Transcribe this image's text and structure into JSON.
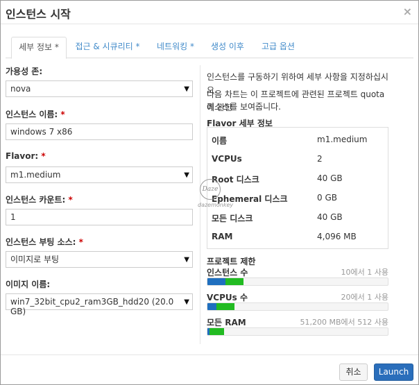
{
  "dialog": {
    "title": "인스턴스 시작",
    "close": "×"
  },
  "tabs": [
    {
      "label": "세부 정보",
      "required": " *",
      "active": true
    },
    {
      "label": "접근 & 시큐리티",
      "required": " *",
      "active": false
    },
    {
      "label": "네트워킹",
      "required": " *",
      "active": false
    },
    {
      "label": "생성 이후",
      "required": "",
      "active": false
    },
    {
      "label": "고급 옵션",
      "required": "",
      "active": false
    }
  ],
  "form": {
    "availability_zone": {
      "label": "가용성 존:",
      "value": "nova"
    },
    "instance_name": {
      "label": "인스턴스 이름:",
      "star": " *",
      "value": "windows 7 x86"
    },
    "flavor": {
      "label": "Flavor:",
      "star": " *",
      "value": "m1.medium"
    },
    "instance_count": {
      "label": "인스턴스 카운트:",
      "star": " *",
      "value": "1"
    },
    "boot_source": {
      "label": "인스턴스 부팅 소스:",
      "star": " *",
      "value": "이미지로 부팅"
    },
    "image_name": {
      "label": "이미지 이름:",
      "value": "win7_32bit_cpu2_ram3GB_hdd20 (20.0 GB)"
    }
  },
  "info": {
    "desc1": "인스턴스를 구동하기 위하여 세부 사항을 지정하십시오.",
    "desc2_line1": "다음 차트는 이 프로젝트에 관련된 프로젝트 quota에 관한",
    "desc2_line2": "리소스를 보여줍니다.",
    "flavor_title": "Flavor 세부 정보",
    "flavor_rows": [
      {
        "key": "이름",
        "value": "m1.medium"
      },
      {
        "key": "VCPUs",
        "value": "2"
      },
      {
        "key": "Root 디스크",
        "value": "40 GB"
      },
      {
        "key": "Ephemeral 디스크",
        "value": "0 GB"
      },
      {
        "key": "모든 디스크",
        "value": "40 GB"
      },
      {
        "key": "RAM",
        "value": "4,096 MB"
      }
    ],
    "quota_title": "프로젝트 제한",
    "quotas": [
      {
        "label": "인스턴스 수",
        "usage": "10에서 1 사용",
        "used_fraction": 0.1,
        "added_fraction": 0.1
      },
      {
        "label": "VCPUs 수",
        "usage": "20에서 1 사용",
        "used_fraction": 0.05,
        "added_fraction": 0.1
      },
      {
        "label": "모든 RAM",
        "usage": "51,200 MB에서 512 사용",
        "used_fraction": 0.01,
        "added_fraction": 0.08
      }
    ]
  },
  "watermark": {
    "logo": "Daze",
    "text": "dazemonkey"
  },
  "buttons": {
    "cancel": "취소",
    "launch": "Launch"
  },
  "colors": {
    "primary": "#2a6ebb",
    "quota_used": "#1f6fbf",
    "quota_added": "#22bb22",
    "link": "#428bca"
  }
}
